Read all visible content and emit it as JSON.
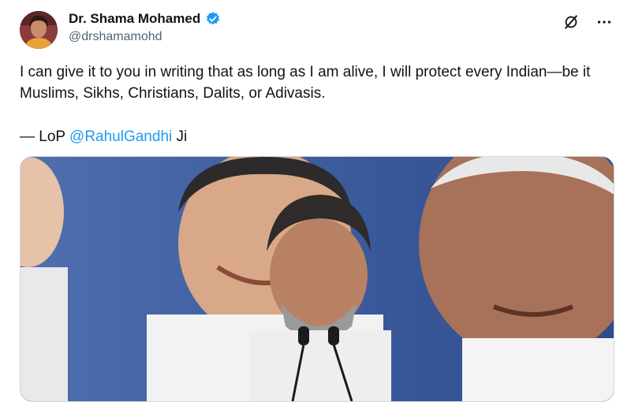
{
  "author": {
    "display_name": "Dr. Shama Mohamed",
    "handle": "@drshamamohd",
    "verified": true
  },
  "tweet": {
    "text": "I can give it to you in writing that as long as I am alive, I will protect every Indian—be it Muslims, Sikhs, Christians, Dalits, or Adivasis.",
    "signoff_prefix": "— LoP ",
    "signoff_mention": "@RahulGandhi",
    "signoff_suffix": " Ji"
  },
  "icons": [
    "avatar",
    "verified-badge-icon",
    "grok-icon",
    "more-options-icon"
  ],
  "colors": {
    "mention": "#1d9bf0",
    "verified": "#1d9bf0",
    "handle": "#536471"
  }
}
